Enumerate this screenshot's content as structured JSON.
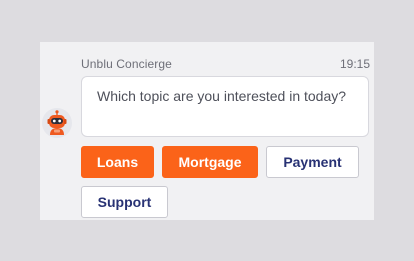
{
  "chat": {
    "sender": "Unblu Concierge",
    "time": "19:15",
    "message": "Which topic are you interested in today?",
    "avatar_icon": "robot-icon"
  },
  "options": {
    "loans": "Loans",
    "mortgage": "Mortgage",
    "payment": "Payment",
    "support": "Support"
  },
  "colors": {
    "primary": "#fb6319",
    "secondary_text": "#283274",
    "panel_bg": "#f1f1f3",
    "page_bg": "#dddce0"
  }
}
